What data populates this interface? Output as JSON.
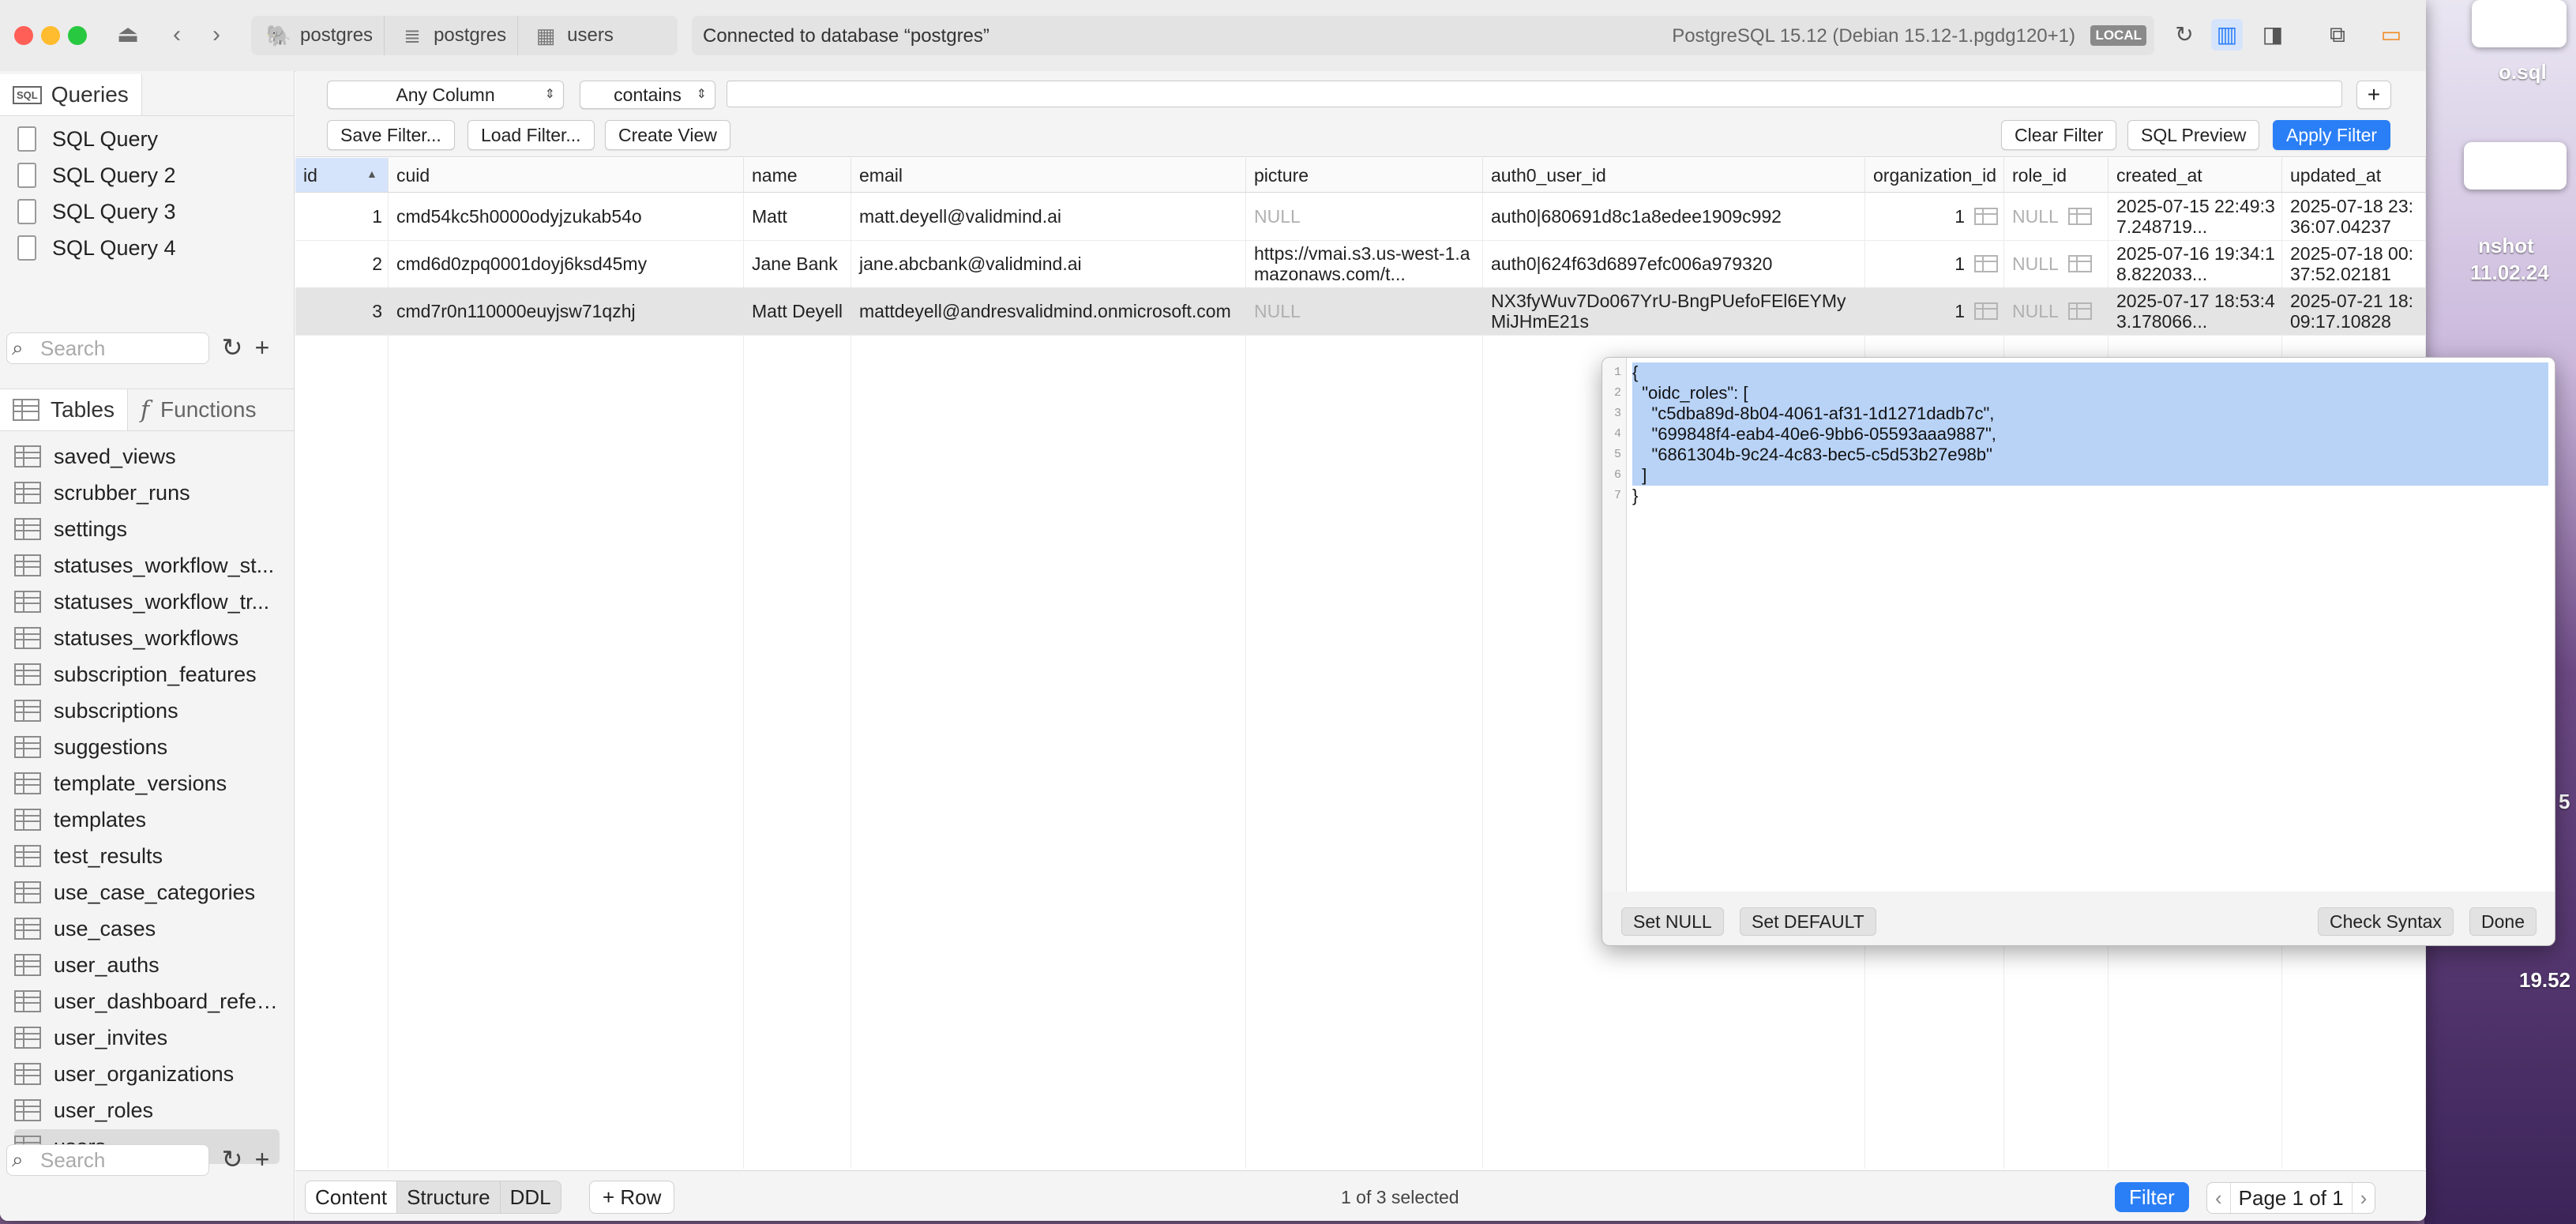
{
  "titlebar": {
    "crumbs": [
      {
        "label": "postgres",
        "icon": "elephant-icon"
      },
      {
        "label": "postgres",
        "icon": "database-icon"
      },
      {
        "label": "users",
        "icon": "table-icon"
      }
    ],
    "connection": "Connected to database “postgres”",
    "version": "PostgreSQL 15.12 (Debian 15.12-1.pgdg120+1)",
    "env_badge": "LOCAL"
  },
  "sidebar": {
    "queries_tab": "Queries",
    "queries": [
      "SQL Query",
      "SQL Query 2",
      "SQL Query 3",
      "SQL Query 4"
    ],
    "search_placeholder": "Search",
    "tables_tab": "Tables",
    "functions_tab": "Functions",
    "tables": [
      "saved_views",
      "scrubber_runs",
      "settings",
      "statuses_workflow_st...",
      "statuses_workflow_tr...",
      "statuses_workflows",
      "subscription_features",
      "subscriptions",
      "suggestions",
      "template_versions",
      "templates",
      "test_results",
      "use_case_categories",
      "use_cases",
      "user_auths",
      "user_dashboard_refer...",
      "user_invites",
      "user_organizations",
      "user_roles",
      "users"
    ],
    "selected_table": "users",
    "bottom_search_placeholder": "Search"
  },
  "filter": {
    "column_select": "Any Column",
    "operator_select": "contains",
    "value": "",
    "add_label": "+",
    "save_filter": "Save Filter...",
    "load_filter": "Load Filter...",
    "create_view": "Create View",
    "clear_filter": "Clear Filter",
    "sql_preview": "SQL Preview",
    "apply_filter": "Apply Filter"
  },
  "table": {
    "columns": [
      "id",
      "cuid",
      "name",
      "email",
      "picture",
      "auth0_user_id",
      "organization_id",
      "role_id",
      "created_at",
      "updated_at"
    ],
    "rows": [
      {
        "id": "1",
        "cuid": "cmd54kc5h0000odyjzukab54o",
        "name": "Matt",
        "email": "matt.deyell@validmind.ai",
        "picture": "NULL",
        "auth0_user_id": "auth0|680691d8c1a8edee1909c992",
        "organization_id": "1",
        "role_id": "NULL",
        "created_at": "2025-07-15 22:49:37.248719...",
        "updated_at": "2025-07-18 23:36:07.04237"
      },
      {
        "id": "2",
        "cuid": "cmd6d0zpq0001doyj6ksd45my",
        "name": "Jane Bank",
        "email": "jane.abcbank@validmind.ai",
        "picture": "https://vmai.s3.us-west-1.amazonaws.com/t...",
        "auth0_user_id": "auth0|624f63d6897efc006a979320",
        "organization_id": "1",
        "role_id": "NULL",
        "created_at": "2025-07-16 19:34:18.822033...",
        "updated_at": "2025-07-18 00:37:52.02181"
      },
      {
        "id": "3",
        "cuid": "cmd7r0n110000euyjsw71qzhj",
        "name": "Matt Deyell",
        "email": "mattdeyell@andresvalidmind.onmicrosoft.com",
        "picture": "NULL",
        "auth0_user_id": "NX3fyWuv7Do067YrU-BngPUefoFEl6EYMyMiJHmE21s",
        "organization_id": "1",
        "role_id": "NULL",
        "created_at": "2025-07-17 18:53:43.178066...",
        "updated_at": "2025-07-21 18:09:17.10828"
      }
    ],
    "selected_row": 3
  },
  "editor": {
    "lines": [
      "{",
      "  \"oidc_roles\": [",
      "    \"c5dba89d-8b04-4061-af31-1d1271dadb7c\",",
      "    \"699848f4-eab4-40e6-9bb6-05593aaa9887\",",
      "    \"6861304b-9c24-4c83-bec5-c5d53b27e98b\"",
      "  ]",
      "}"
    ],
    "set_null": "Set NULL",
    "set_default": "Set DEFAULT",
    "check_syntax": "Check Syntax",
    "done": "Done"
  },
  "bottom": {
    "tabs": [
      "Content",
      "Structure",
      "DDL"
    ],
    "active_tab": "Content",
    "add_row": "+ Row",
    "selection": "1 of 3 selected",
    "filter": "Filter",
    "page": "Page 1 of 1"
  },
  "desktop": {
    "frag1": "o.sql",
    "frag2": "nshot",
    "frag3": "11.02.24",
    "frag4": "5",
    "frag5": "19.52"
  },
  "colors": {
    "accent": "#2b7ff6",
    "selection": "#b9d3f7",
    "null_text": "#b0b0b0"
  }
}
